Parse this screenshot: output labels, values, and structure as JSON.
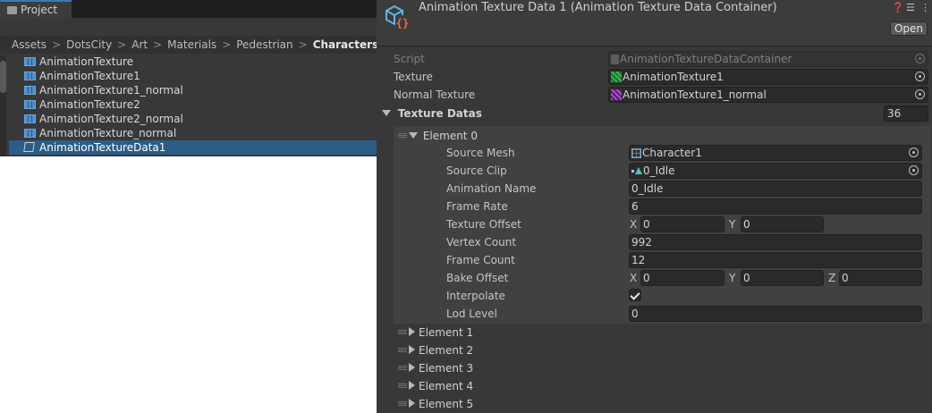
{
  "project": {
    "tab_label": "Project",
    "breadcrumb": [
      "Assets",
      "DotsCity",
      "Art",
      "Materials",
      "Pedestrian"
    ],
    "breadcrumb_last": "Characters",
    "items": [
      {
        "name": "AnimationTexture",
        "icon": "texture-icon"
      },
      {
        "name": "AnimationTexture1",
        "icon": "texture-icon"
      },
      {
        "name": "AnimationTexture1_normal",
        "icon": "texture-icon"
      },
      {
        "name": "AnimationTexture2",
        "icon": "texture-icon"
      },
      {
        "name": "AnimationTexture2_normal",
        "icon": "texture-icon"
      },
      {
        "name": "AnimationTexture_normal",
        "icon": "texture-icon"
      },
      {
        "name": "AnimationTextureData1",
        "icon": "scriptable-object-icon",
        "selected": true
      }
    ]
  },
  "inspector": {
    "title": "Animation Texture Data 1 (Animation Texture Data Container)",
    "open_label": "Open",
    "accent_color": "#f26a2a",
    "selection_color": "#2c5d87",
    "script": {
      "label": "Script",
      "value": "AnimationTextureDataContainer"
    },
    "texture": {
      "label": "Texture",
      "value": "AnimationTexture1"
    },
    "normal_texture": {
      "label": "Normal Texture",
      "value": "AnimationTexture1_normal"
    },
    "texture_datas": {
      "label": "Texture Datas",
      "count": "36"
    },
    "element0": {
      "label": "Element 0",
      "source_mesh": {
        "label": "Source Mesh",
        "value": "Character1"
      },
      "source_clip": {
        "label": "Source Clip",
        "value": "0_Idle"
      },
      "animation_name": {
        "label": "Animation Name",
        "value": "0_Idle"
      },
      "frame_rate": {
        "label": "Frame Rate",
        "value": "6"
      },
      "texture_offset": {
        "label": "Texture Offset",
        "x_label": "X",
        "x": "0",
        "y_label": "Y",
        "y": "0"
      },
      "vertex_count": {
        "label": "Vertex Count",
        "value": "992"
      },
      "frame_count": {
        "label": "Frame Count",
        "value": "12"
      },
      "bake_offset": {
        "label": "Bake Offset",
        "x_label": "X",
        "x": "0",
        "y_label": "Y",
        "y": "0",
        "z_label": "Z",
        "z": "0"
      },
      "interpolate": {
        "label": "Interpolate",
        "checked": true
      },
      "lod_level": {
        "label": "Lod Level",
        "value": "0"
      }
    },
    "collapsed_elements": [
      "Element 1",
      "Element 2",
      "Element 3",
      "Element 4",
      "Element 5"
    ]
  }
}
